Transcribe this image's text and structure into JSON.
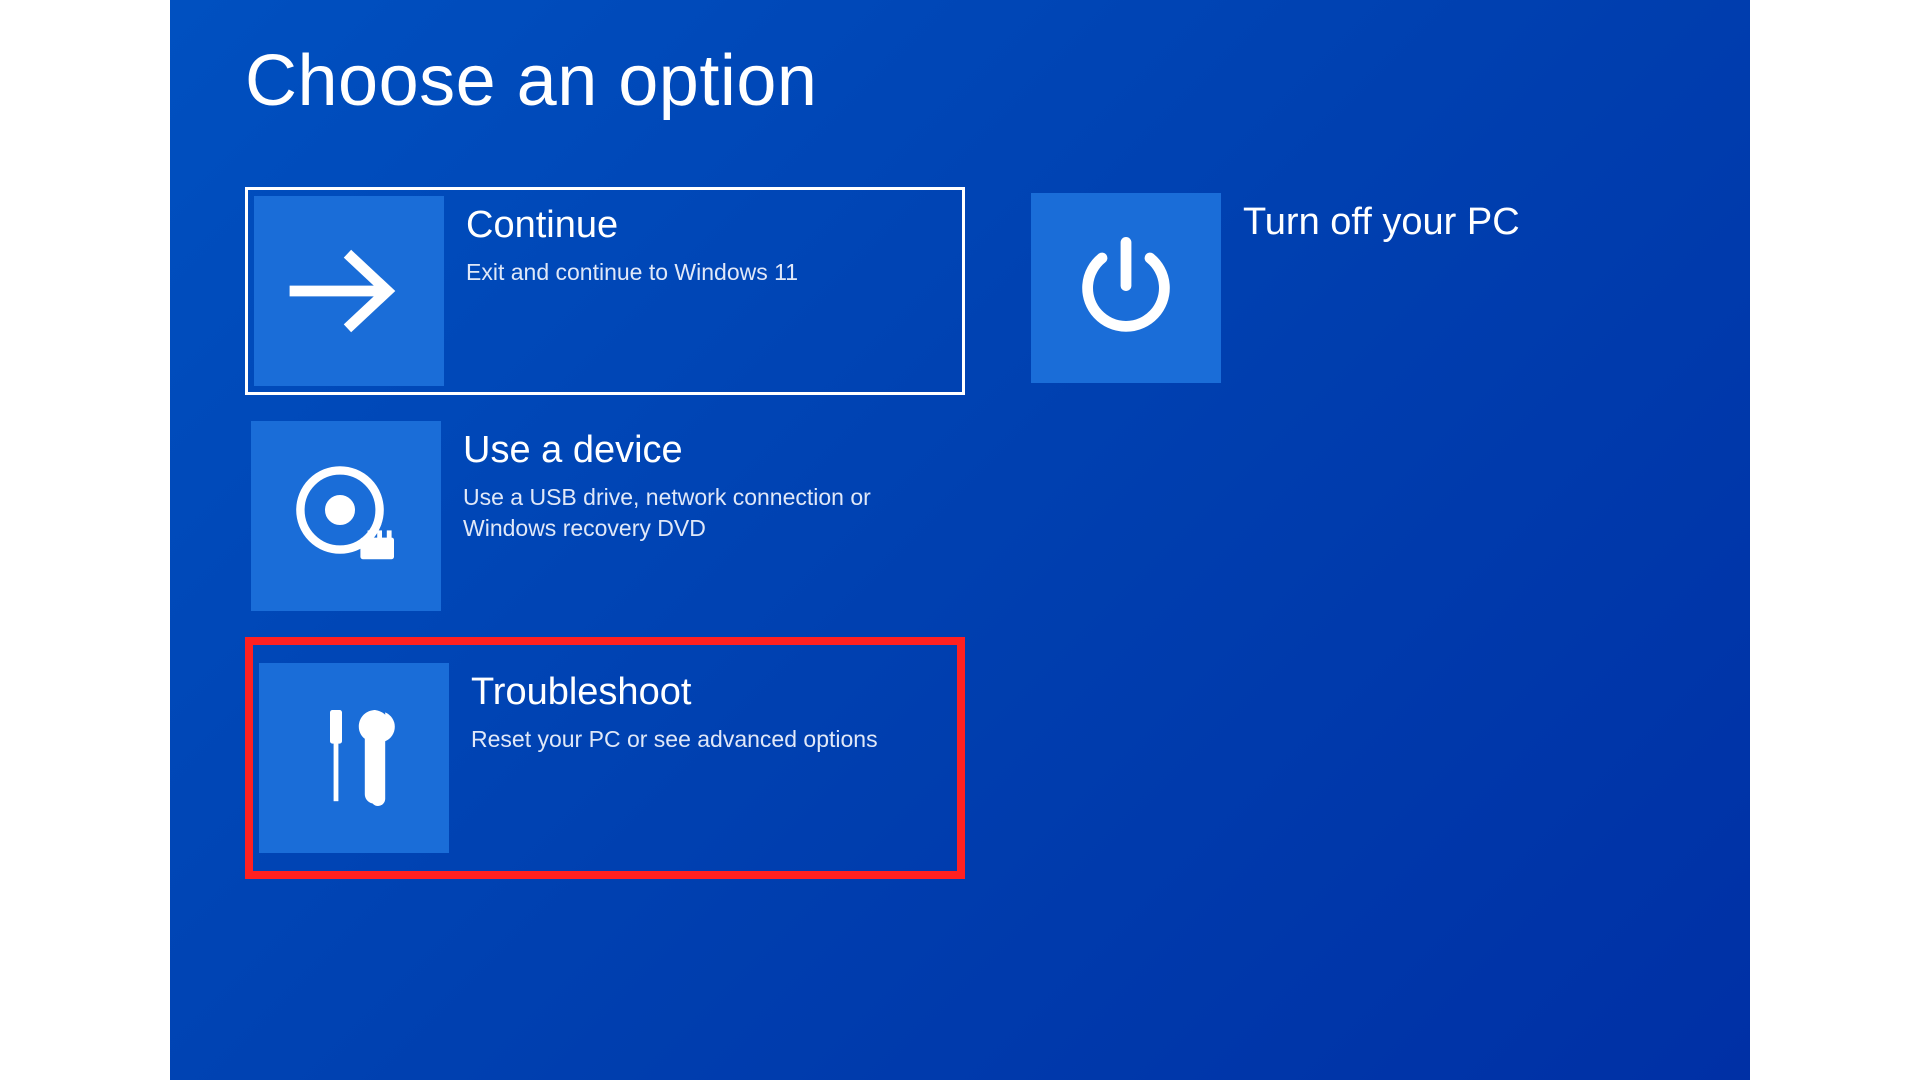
{
  "title": "Choose an option",
  "options": {
    "continue": {
      "title": "Continue",
      "description": "Exit and continue to Windows 11"
    },
    "use_device": {
      "title": "Use a device",
      "description": "Use a USB drive, network connection or Windows recovery DVD"
    },
    "troubleshoot": {
      "title": "Troubleshoot",
      "description": "Reset your PC or see advanced options"
    },
    "turn_off": {
      "title": "Turn off your PC",
      "description": ""
    }
  },
  "colors": {
    "background": "#0040b0",
    "tile": "#1a6dd8",
    "highlight": "#ff2020"
  }
}
